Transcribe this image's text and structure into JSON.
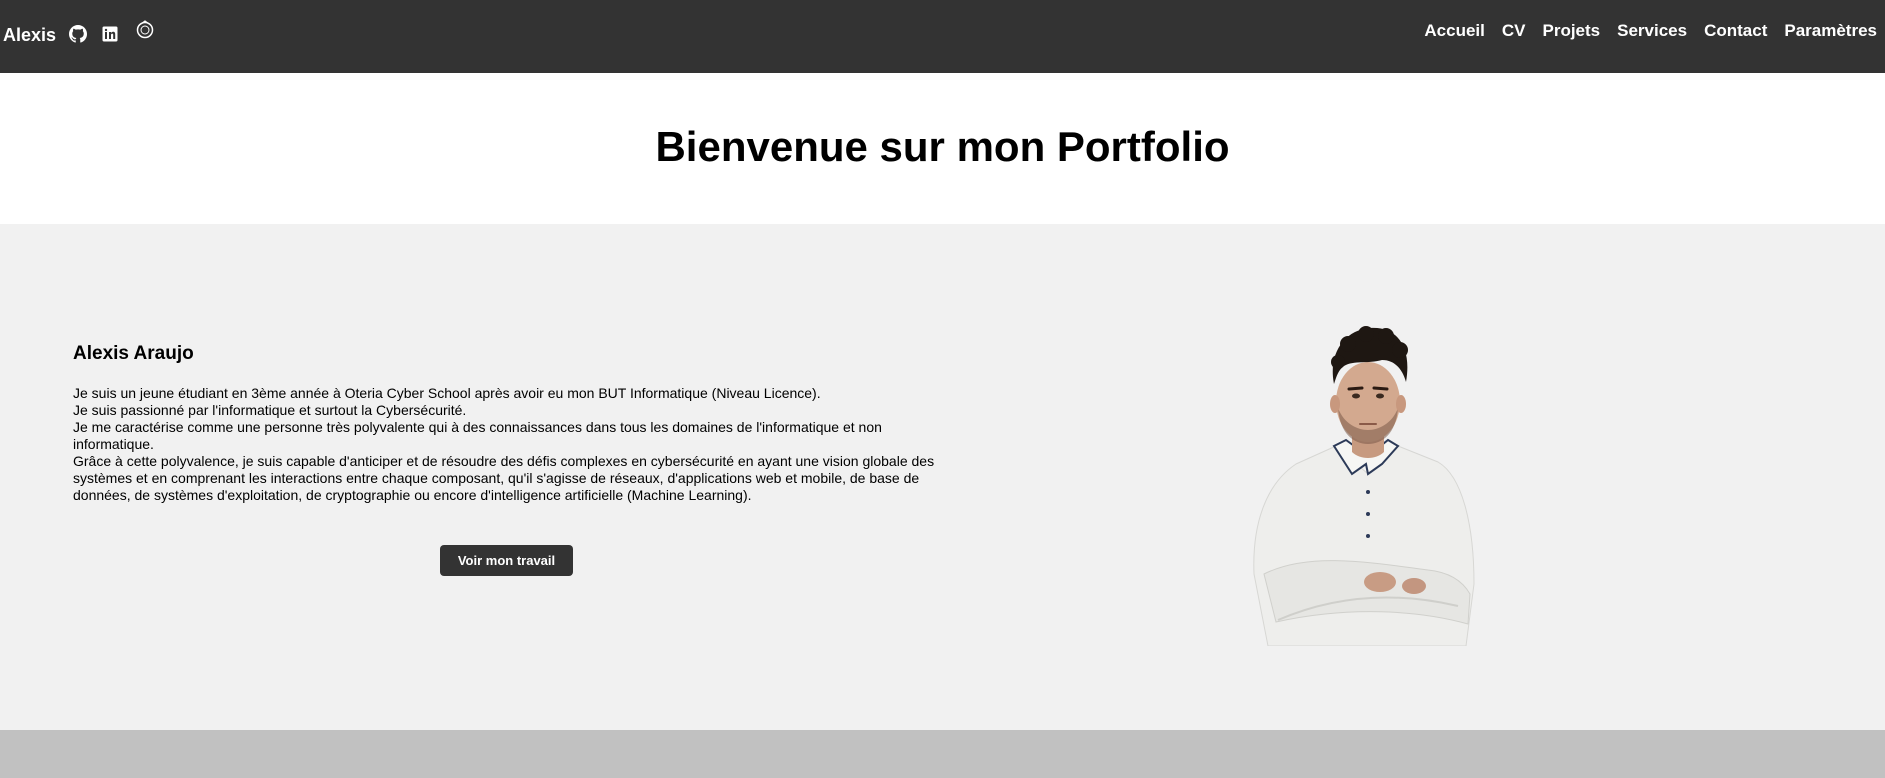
{
  "header": {
    "brand": "Alexis",
    "social_icons": [
      "github-icon",
      "linkedin-icon",
      "badge-icon"
    ],
    "nav": [
      "Accueil",
      "CV",
      "Projets",
      "Services",
      "Contact",
      "Paramètres"
    ]
  },
  "hero": {
    "title": "Bienvenue sur mon Portfolio"
  },
  "about": {
    "name": "Alexis Araujo",
    "lines": [
      "Je suis un jeune étudiant en 3ème année à Oteria Cyber School après avoir eu mon BUT Informatique (Niveau Licence).",
      "Je suis passionné par l'informatique et surtout la Cybersécurité.",
      "Je me caractérise comme une personne très polyvalente qui à des connaissances dans tous les domaines de l'informatique et non informatique.",
      "Grâce à cette polyvalence, je suis capable d'anticiper et de résoudre des défis complexes en cybersécurité en ayant une vision globale des systèmes et en comprenant les interactions entre chaque composant, qu'il s'agisse de réseaux, d'applications web et mobile, de base de données, de systèmes d'exploitation, de cryptographie ou encore d'intelligence artificielle (Machine Learning)."
    ],
    "cta_label": "Voir mon travail"
  },
  "colors": {
    "navbar": "#333333",
    "section_bg": "#f1f1f1",
    "footer": "#c1c1c1",
    "button": "#333333"
  }
}
